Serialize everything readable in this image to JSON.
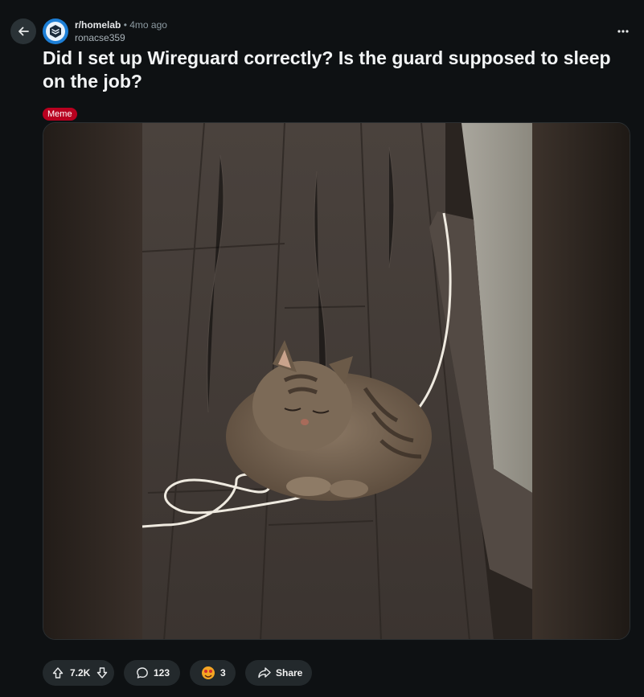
{
  "post": {
    "subreddit": "r/homelab",
    "separator": "•",
    "age": "4mo ago",
    "author": "ronacse359",
    "title": "Did I set up Wireguard correctly? Is the guard supposed to sleep on the job?",
    "flair": "Meme"
  },
  "actions": {
    "votes": "7.2K",
    "comments": "123",
    "awards": "3",
    "share_label": "Share"
  },
  "icons": {
    "back": "arrow-left-icon",
    "more": "ellipsis-icon",
    "upvote": "arrow-up-icon",
    "downvote": "arrow-down-icon",
    "comment": "speech-bubble-icon",
    "award": "award-icon",
    "share": "share-arrow-icon"
  },
  "colors": {
    "background": "#0e1113",
    "flair": "#b8001f",
    "pill": "#23292c",
    "avatar": "#1d7fd6"
  }
}
